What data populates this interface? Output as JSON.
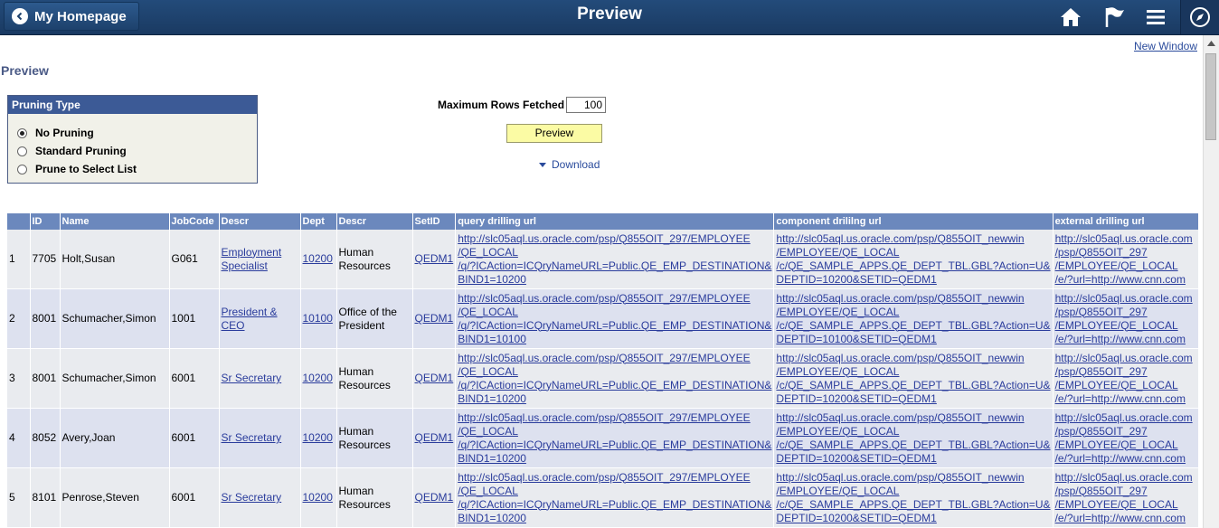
{
  "header": {
    "back_label": "My Homepage",
    "title": "Preview",
    "icons": [
      "home-icon",
      "flag-icon",
      "menu-icon",
      "navbar-compass-icon"
    ]
  },
  "new_window": "New Window",
  "page_title": "Preview",
  "pruning": {
    "title": "Pruning Type",
    "options": [
      {
        "label": "No Pruning",
        "selected": true
      },
      {
        "label": "Standard Pruning",
        "selected": false
      },
      {
        "label": "Prune to Select List",
        "selected": false
      }
    ]
  },
  "max_rows": {
    "label": "Maximum Rows Fetched",
    "value": "100"
  },
  "preview_button": "Preview",
  "download": "Download",
  "grid": {
    "columns": [
      "",
      "ID",
      "Name",
      "JobCode",
      "Descr",
      "Dept",
      "Descr",
      "SetID",
      "query drilling url",
      "component drililng url",
      "external drilling url"
    ],
    "rows": [
      {
        "num": "1",
        "id": "7705",
        "name": "Holt,Susan",
        "jobcode": "G061",
        "jobdescr": [
          "Employment",
          "Specialist"
        ],
        "dept": "10200",
        "deptdescr": [
          "Human",
          "Resources"
        ],
        "setid": "QEDM1",
        "q": [
          "http://slc05aql.us.oracle.com/psp/Q855OIT_297/EMPLOYEE",
          "/QE_LOCAL",
          "/q/?ICAction=ICQryNameURL=Public.QE_EMP_DESTINATION&",
          "BIND1=10200"
        ],
        "c": [
          "http://slc05aql.us.oracle.com/psp/Q855OIT_newwin",
          "/EMPLOYEE/QE_LOCAL",
          "/c/QE_SAMPLE_APPS.QE_DEPT_TBL.GBL?Action=U&",
          "DEPTID=10200&SETID=QEDM1"
        ],
        "e": [
          "http://slc05aql.us.oracle.com",
          "/psp/Q855OIT_297",
          "/EMPLOYEE/QE_LOCAL",
          "/e/?url=http://www.cnn.com"
        ]
      },
      {
        "num": "2",
        "id": "8001",
        "name": "Schumacher,Simon",
        "jobcode": "1001",
        "jobdescr": [
          "President &",
          "CEO"
        ],
        "dept": "10100",
        "deptdescr": [
          "Office of the",
          "President"
        ],
        "setid": "QEDM1",
        "q": [
          "http://slc05aql.us.oracle.com/psp/Q855OIT_297/EMPLOYEE",
          "/QE_LOCAL",
          "/q/?ICAction=ICQryNameURL=Public.QE_EMP_DESTINATION&",
          "BIND1=10100"
        ],
        "c": [
          "http://slc05aql.us.oracle.com/psp/Q855OIT_newwin",
          "/EMPLOYEE/QE_LOCAL",
          "/c/QE_SAMPLE_APPS.QE_DEPT_TBL.GBL?Action=U&",
          "DEPTID=10100&SETID=QEDM1"
        ],
        "e": [
          "http://slc05aql.us.oracle.com",
          "/psp/Q855OIT_297",
          "/EMPLOYEE/QE_LOCAL",
          "/e/?url=http://www.cnn.com"
        ]
      },
      {
        "num": "3",
        "id": "8001",
        "name": "Schumacher,Simon",
        "jobcode": "6001",
        "jobdescr": [
          "Sr Secretary"
        ],
        "dept": "10200",
        "deptdescr": [
          "Human",
          "Resources"
        ],
        "setid": "QEDM1",
        "q": [
          "http://slc05aql.us.oracle.com/psp/Q855OIT_297/EMPLOYEE",
          "/QE_LOCAL",
          "/q/?ICAction=ICQryNameURL=Public.QE_EMP_DESTINATION&",
          "BIND1=10200"
        ],
        "c": [
          "http://slc05aql.us.oracle.com/psp/Q855OIT_newwin",
          "/EMPLOYEE/QE_LOCAL",
          "/c/QE_SAMPLE_APPS.QE_DEPT_TBL.GBL?Action=U&",
          "DEPTID=10200&SETID=QEDM1"
        ],
        "e": [
          "http://slc05aql.us.oracle.com",
          "/psp/Q855OIT_297",
          "/EMPLOYEE/QE_LOCAL",
          "/e/?url=http://www.cnn.com"
        ]
      },
      {
        "num": "4",
        "id": "8052",
        "name": "Avery,Joan",
        "jobcode": "6001",
        "jobdescr": [
          "Sr Secretary"
        ],
        "dept": "10200",
        "deptdescr": [
          "Human",
          "Resources"
        ],
        "setid": "QEDM1",
        "q": [
          "http://slc05aql.us.oracle.com/psp/Q855OIT_297/EMPLOYEE",
          "/QE_LOCAL",
          "/q/?ICAction=ICQryNameURL=Public.QE_EMP_DESTINATION&",
          "BIND1=10200"
        ],
        "c": [
          "http://slc05aql.us.oracle.com/psp/Q855OIT_newwin",
          "/EMPLOYEE/QE_LOCAL",
          "/c/QE_SAMPLE_APPS.QE_DEPT_TBL.GBL?Action=U&",
          "DEPTID=10200&SETID=QEDM1"
        ],
        "e": [
          "http://slc05aql.us.oracle.com",
          "/psp/Q855OIT_297",
          "/EMPLOYEE/QE_LOCAL",
          "/e/?url=http://www.cnn.com"
        ]
      },
      {
        "num": "5",
        "id": "8101",
        "name": "Penrose,Steven",
        "jobcode": "6001",
        "jobdescr": [
          "Sr Secretary"
        ],
        "dept": "10200",
        "deptdescr": [
          "Human",
          "Resources"
        ],
        "setid": "QEDM1",
        "q": [
          "http://slc05aql.us.oracle.com/psp/Q855OIT_297/EMPLOYEE",
          "/QE_LOCAL",
          "/q/?ICAction=ICQryNameURL=Public.QE_EMP_DESTINATION&",
          "BIND1=10200"
        ],
        "c": [
          "http://slc05aql.us.oracle.com/psp/Q855OIT_newwin",
          "/EMPLOYEE/QE_LOCAL",
          "/c/QE_SAMPLE_APPS.QE_DEPT_TBL.GBL?Action=U&",
          "DEPTID=10200&SETID=QEDM1"
        ],
        "e": [
          "http://slc05aql.us.oracle.com",
          "/psp/Q855OIT_297",
          "/EMPLOYEE/QE_LOCAL",
          "/e/?url=http://www.cnn.com"
        ]
      }
    ]
  }
}
